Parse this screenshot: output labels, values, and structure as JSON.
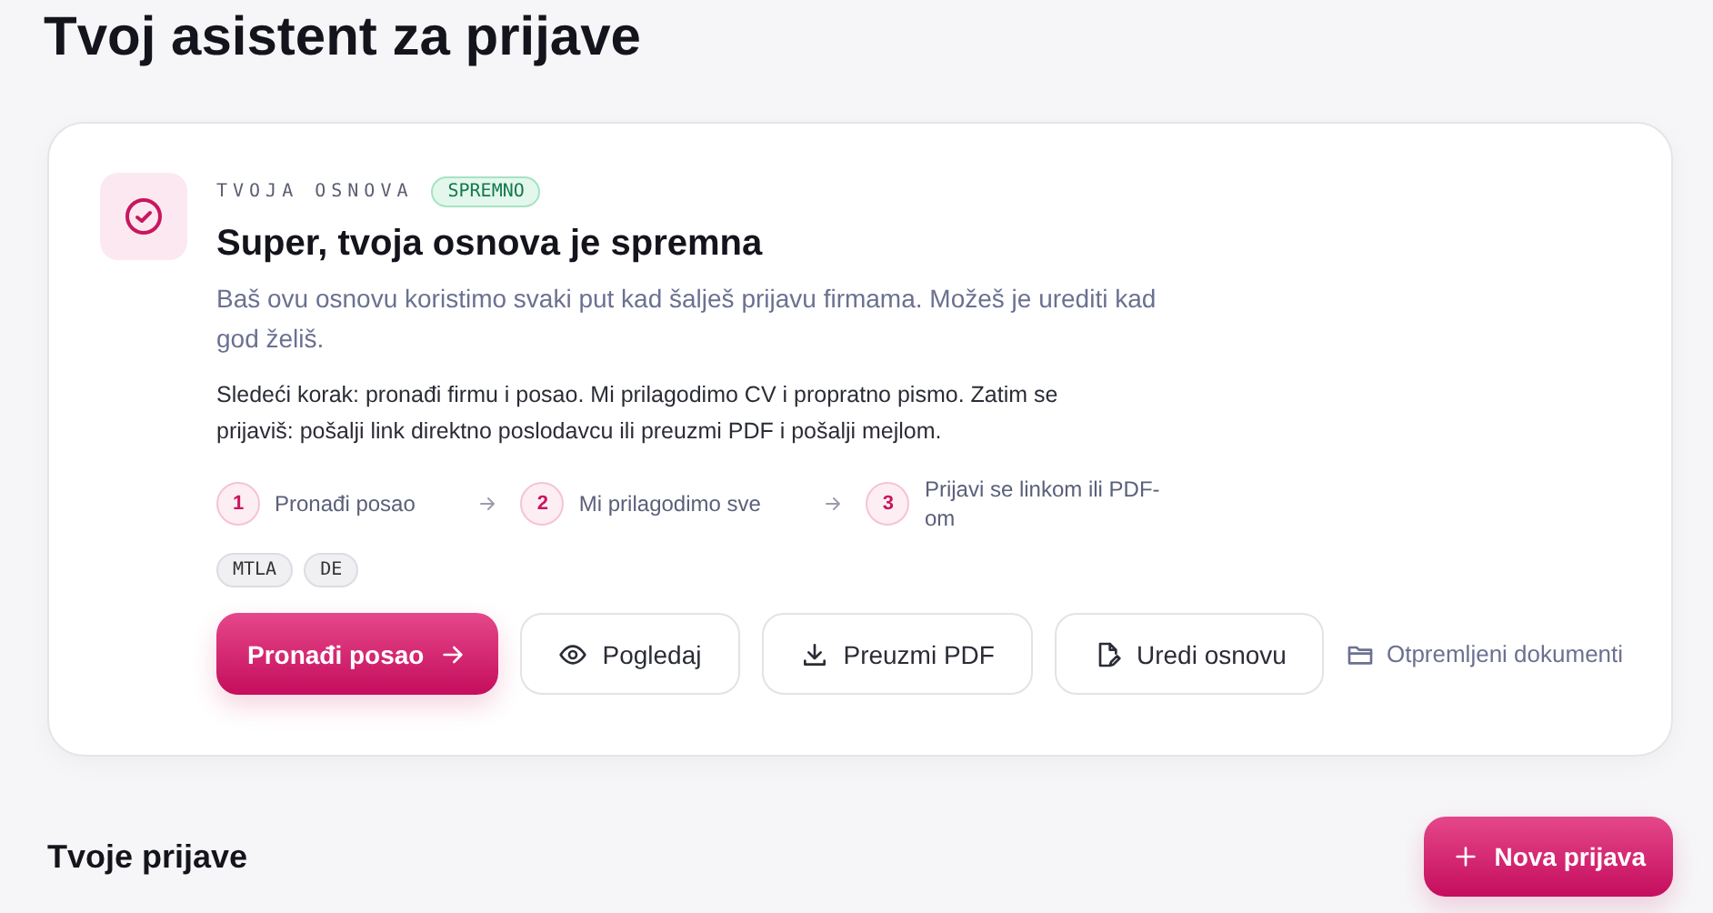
{
  "page_title": "Tvoj asistent za prijave",
  "base_card": {
    "eyebrow": "TVOJA OSNOVA",
    "status_badge": "SPREMNO",
    "heading": "Super, tvoja osnova je spremna",
    "description": "Baš ovu osnovu koristimo svaki put kad šalješ prijavu firmama. Možeš je urediti kad god želiš.",
    "next_step": "Sledeći korak: pronađi firmu i posao. Mi prilagodimo CV i propratno pismo. Zatim se prijaviš: pošalji link direktno poslodavcu ili preuzmi PDF i pošalji mejlom.",
    "steps": [
      {
        "number": "1",
        "label": "Pronađi posao"
      },
      {
        "number": "2",
        "label": "Mi prilagodimo sve"
      },
      {
        "number": "3",
        "label": "Prijavi se linkom ili PDF-om"
      }
    ],
    "tags": [
      "MTLA",
      "DE"
    ],
    "actions": [
      {
        "kind": "primary",
        "label": "Pronađi posao"
      },
      {
        "kind": "outline",
        "label": "Pogledaj"
      },
      {
        "kind": "outline",
        "label": "Preuzmi PDF"
      },
      {
        "kind": "outline",
        "label": "Uredi osnovu"
      },
      {
        "kind": "link",
        "label": "Otpremljeni dokumenti"
      }
    ]
  },
  "applications": {
    "heading": "Tvoje prijave",
    "new_button": "Nova prijava"
  }
}
